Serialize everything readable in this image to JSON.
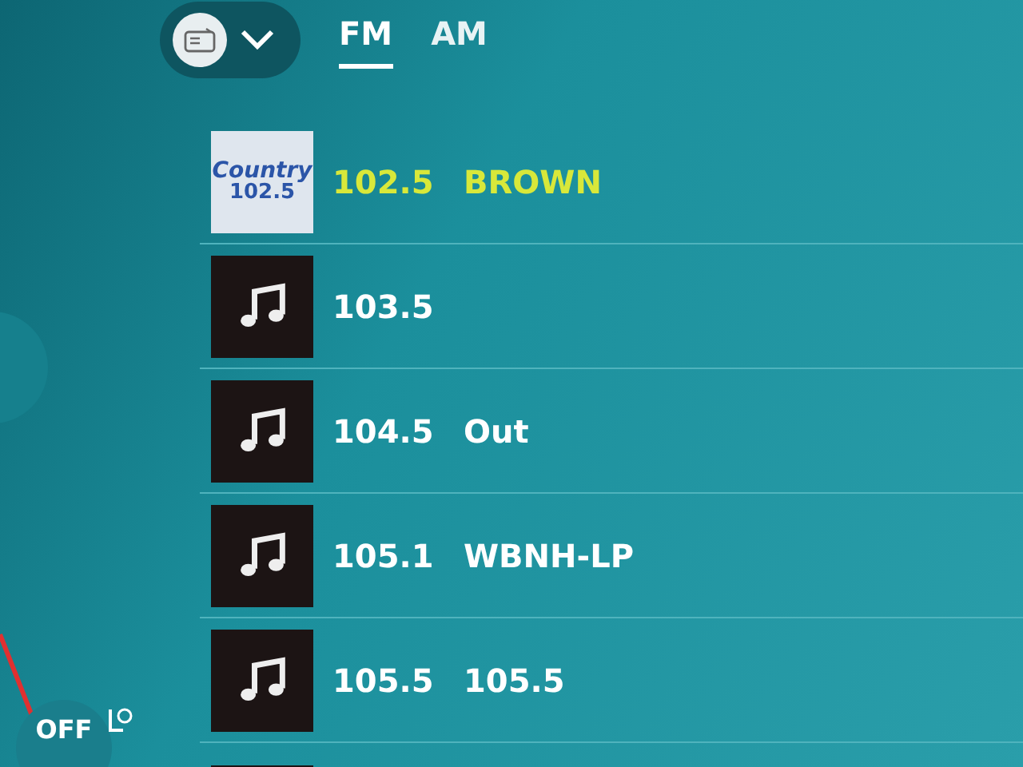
{
  "source_button": {
    "expanded": false
  },
  "tabs": [
    {
      "label": "FM",
      "selected": true
    },
    {
      "label": "AM",
      "selected": false
    }
  ],
  "stations": [
    {
      "kind": "logo",
      "logo_text": [
        "Country",
        "102.5"
      ],
      "frequency": "102.5",
      "name": "BROWN",
      "playing": true
    },
    {
      "kind": "music",
      "frequency": "103.5",
      "playing": false
    },
    {
      "kind": "music",
      "frequency": "104.5",
      "name": "Out",
      "playing": false
    },
    {
      "kind": "music",
      "frequency": "105.1",
      "name": "WBNH-LP",
      "playing": false
    },
    {
      "kind": "music",
      "frequency": "105.5",
      "name": "105.5",
      "playing": false
    }
  ],
  "power_button": {
    "label": "OFF"
  }
}
